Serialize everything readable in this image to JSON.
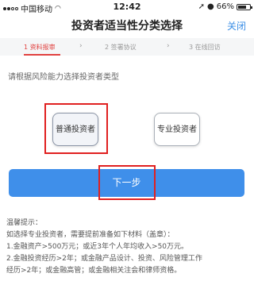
{
  "status_bar": {
    "carrier": "中国移动",
    "time": "12:42",
    "battery": "66%"
  },
  "nav": {
    "title": "投资者适当性分类选择",
    "close_label": "关闭"
  },
  "steps": [
    {
      "label": "1 资料报审"
    },
    {
      "label": "2 签署协议"
    },
    {
      "label": "3 在线回访"
    }
  ],
  "steps_chevron": "›",
  "prompt": "请根据风险能力选择投资者类型",
  "investor_types": {
    "ordinary": "普通投资者",
    "professional": "专业投资者"
  },
  "next_button_label": "下一步",
  "notes": {
    "heading": "温馨提示：",
    "line1": "如选择专业投资者，需要提前准备如下材料（盖章）：",
    "line2": "1.金融资产>500万元；或近3年个人年均收入>50万元。",
    "line3": "2.金融投资经历>2年；或金融产品设计、投资、风险管理工作",
    "line4": "经历>2年；或金融高管；或金融相关注会和律师资格。"
  },
  "colors": {
    "accent_red": "#e1413f",
    "button_blue": "#3f8fea",
    "close_blue": "#3a8ee6",
    "highlight_red": "#e02020"
  }
}
